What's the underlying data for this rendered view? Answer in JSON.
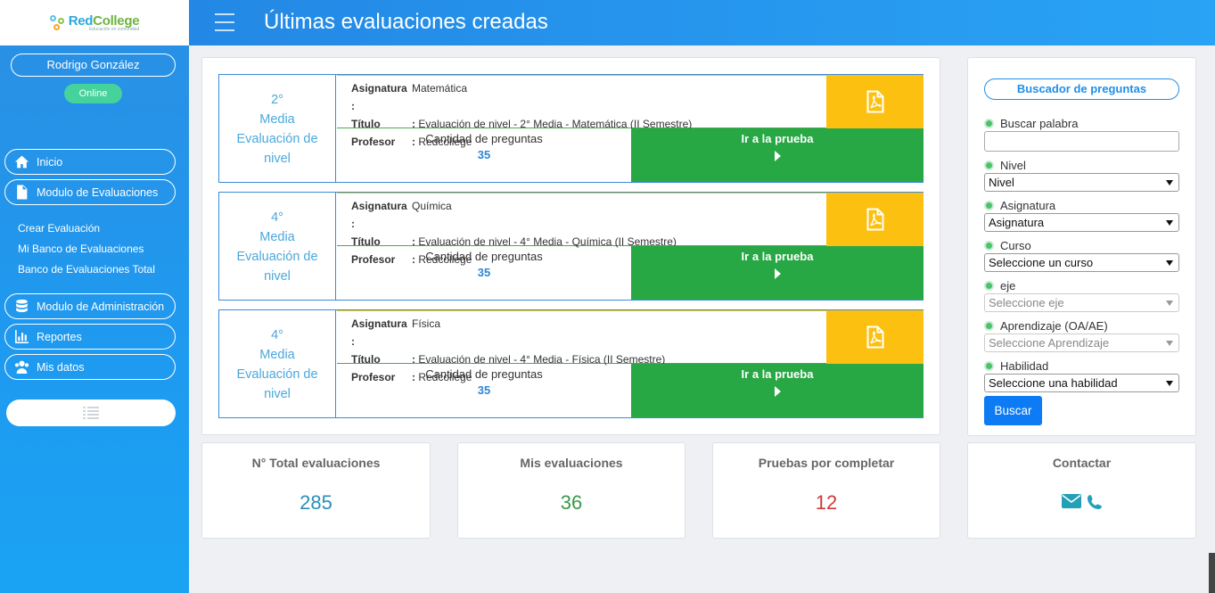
{
  "brand": {
    "name_a": "Red",
    "name_b": "College",
    "tagline": "Educación en comunidad"
  },
  "user": {
    "name": "Rodrigo González",
    "status": "Online"
  },
  "sidebar": {
    "items": [
      {
        "label": "Inicio",
        "icon": "home-icon"
      },
      {
        "label": "Modulo de Evaluaciones",
        "icon": "file-icon"
      },
      {
        "label": "Modulo de Administración",
        "icon": "database-icon"
      },
      {
        "label": "Reportes",
        "icon": "bar-chart-icon"
      },
      {
        "label": "Mis datos",
        "icon": "users-icon"
      }
    ],
    "sub_items": [
      {
        "label": "Crear Evaluación"
      },
      {
        "label": "Mi Banco de Evaluaciones"
      },
      {
        "label": "Banco de Evaluaciones Total"
      }
    ]
  },
  "header": {
    "title": "Últimas evaluaciones creadas"
  },
  "evaluations": [
    {
      "level_num": "2°",
      "level_name": "Media",
      "type_a": "Evaluación de",
      "type_b": "nivel",
      "asignatura_label": "Asignatura :",
      "asignatura": "Matemática",
      "titulo_label": "Título",
      "titulo": "Evaluación de nivel - 2° Media - Matemática (II Semestre)",
      "profesor_label": "Profesor",
      "profesor": "Redcollege",
      "count_label": "Cantidad de preguntas",
      "count": "35",
      "go_label": "Ir a la prueba"
    },
    {
      "level_num": "4°",
      "level_name": "Media",
      "type_a": "Evaluación de",
      "type_b": "nivel",
      "asignatura_label": "Asignatura :",
      "asignatura": "Química",
      "titulo_label": "Título",
      "titulo": "Evaluación de nivel - 4° Media - Química (II Semestre)",
      "profesor_label": "Profesor",
      "profesor": "Redcollege",
      "count_label": "Cantidad de preguntas",
      "count": "35",
      "go_label": "Ir a la prueba"
    },
    {
      "level_num": "4°",
      "level_name": "Media",
      "type_a": "Evaluación de",
      "type_b": "nivel",
      "asignatura_label": "Asignatura :",
      "asignatura": "Física",
      "titulo_label": "Título",
      "titulo": "Evaluación de nivel - 4° Media - Física (II Semestre)",
      "profesor_label": "Profesor",
      "profesor": "Redcollege",
      "count_label": "Cantidad de preguntas",
      "count": "35",
      "go_label": "Ir a la prueba"
    }
  ],
  "search": {
    "title": "Buscador de preguntas",
    "fields": [
      {
        "label": "Buscar palabra",
        "value": ""
      },
      {
        "label": "Nivel",
        "value": "Nivel"
      },
      {
        "label": "Asignatura",
        "value": "Asignatura"
      },
      {
        "label": "Curso",
        "value": "Seleccione un curso"
      },
      {
        "label": "eje",
        "value": "Seleccione eje"
      },
      {
        "label": "Aprendizaje (OA/AE)",
        "value": "Seleccione Aprendizaje"
      },
      {
        "label": "Habilidad",
        "value": "Seleccione una habilidad"
      }
    ],
    "button": "Buscar"
  },
  "stats": [
    {
      "label": "N° Total evaluaciones",
      "value": "285",
      "color": "#2a8fb8"
    },
    {
      "label": "Mis evaluaciones",
      "value": "36",
      "color": "#3a9a48"
    },
    {
      "label": "Pruebas por completar",
      "value": "12",
      "color": "#d0393c"
    }
  ],
  "contact": {
    "label": "Contactar",
    "icons": [
      "envelope-icon",
      "phone-icon"
    ],
    "color": "#22a0b8"
  },
  "colors": {
    "accent": "#1f8fe8",
    "pdf_bg": "#fcc010",
    "go_bg": "#28a745",
    "online": "#45d29b"
  }
}
